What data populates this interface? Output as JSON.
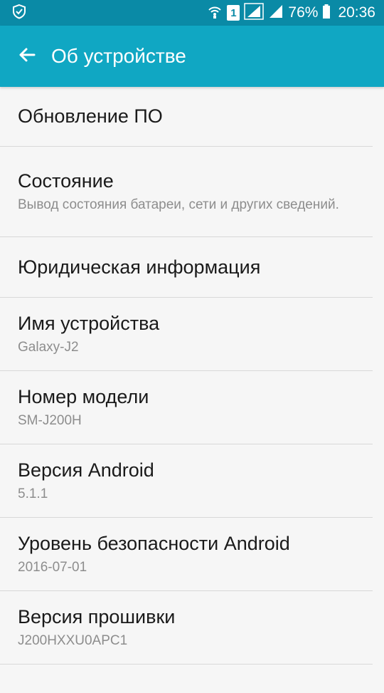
{
  "status_bar": {
    "sim_slot": "1",
    "battery": "76%",
    "time": "20:36"
  },
  "appbar": {
    "title": "Об устройстве"
  },
  "items": [
    {
      "title": "Обновление ПО",
      "subtitle": ""
    },
    {
      "title": "Состояние",
      "subtitle": "Вывод состояния батареи, сети и других сведений."
    },
    {
      "title": "Юридическая информация",
      "subtitle": ""
    },
    {
      "title": "Имя устройства",
      "subtitle": "Galaxy-J2"
    },
    {
      "title": "Номер модели",
      "subtitle": "SM-J200H"
    },
    {
      "title": "Версия Android",
      "subtitle": "5.1.1"
    },
    {
      "title": "Уровень безопасности Android",
      "subtitle": "2016-07-01"
    },
    {
      "title": "Версия прошивки",
      "subtitle": "J200HXXU0APC1"
    }
  ],
  "colors": {
    "status_bar": "#0a8aa6",
    "appbar": "#10a7c3",
    "background": "#f6f6f6"
  }
}
